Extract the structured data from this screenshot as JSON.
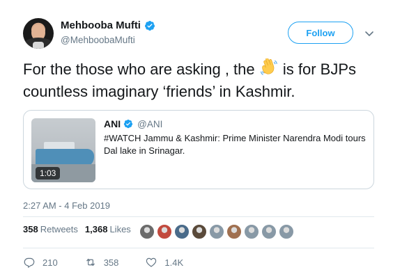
{
  "author": {
    "display_name": "Mehbooba Mufti",
    "handle": "@MehboobaMufti",
    "verified": true,
    "avatar_icon": "profile-photo"
  },
  "follow": {
    "label": "Follow"
  },
  "tweet": {
    "text_before": "For the  those who are asking , the",
    "emoji": "waving-hand-icon",
    "text_after": "is for BJPs countless imaginary ‘friends’ in Kashmir."
  },
  "quoted": {
    "name": "ANI",
    "handle": "@ANI",
    "text": "#WATCH Jammu & Kashmir: Prime Minister Narendra Modi tours Dal lake in Srinagar.",
    "video_duration": "1:03"
  },
  "timestamp": "2:27 AM - 4 Feb 2019",
  "stats": {
    "retweets_count": "358",
    "retweets_label": "Retweets",
    "likes_count": "1,368",
    "likes_label": "Likes",
    "likers": [
      "#6b6b6b",
      "#c24a3e",
      "#4a6b8a",
      "#5a4a3a",
      "#8899a6",
      "#a07050",
      "#8899a6",
      "#8899a6",
      "#8899a6"
    ]
  },
  "actions": {
    "replies": "210",
    "retweets": "358",
    "likes": "1.4K"
  },
  "colors": {
    "accent": "#1da1f2",
    "muted": "#657786",
    "text": "#14171a",
    "border": "#e1e8ed"
  }
}
